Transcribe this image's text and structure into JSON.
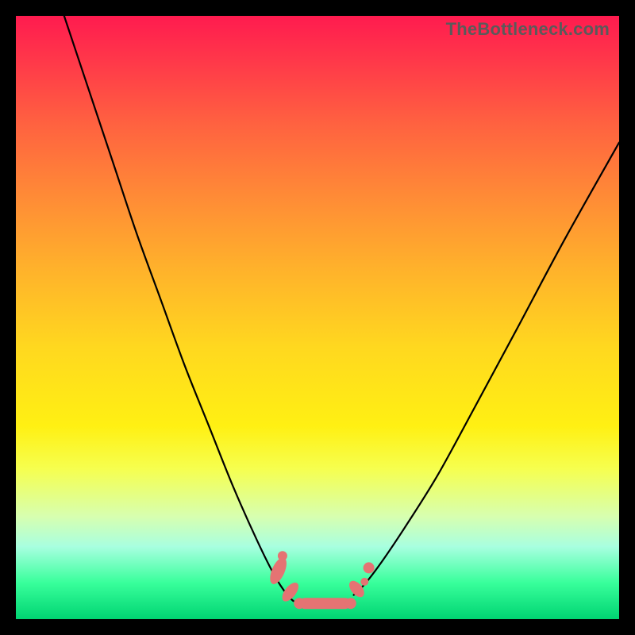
{
  "watermark": "TheBottleneck.com",
  "chart_data": {
    "type": "line",
    "title": "",
    "xlabel": "",
    "ylabel": "",
    "xlim": [
      0,
      100
    ],
    "ylim": [
      0,
      100
    ],
    "series": [
      {
        "name": "left-curve",
        "x": [
          8,
          12,
          16,
          20,
          24,
          28,
          32,
          36,
          40,
          43,
          45,
          46
        ],
        "y": [
          100,
          88,
          76,
          64,
          53,
          42,
          32,
          22,
          13,
          7,
          4,
          3
        ]
      },
      {
        "name": "right-curve",
        "x": [
          56,
          58,
          61,
          65,
          70,
          76,
          83,
          91,
          100
        ],
        "y": [
          4,
          6,
          10,
          16,
          24,
          35,
          48,
          63,
          79
        ]
      }
    ],
    "valley_markers": {
      "x_range": [
        44,
        58
      ],
      "y": 3
    }
  }
}
